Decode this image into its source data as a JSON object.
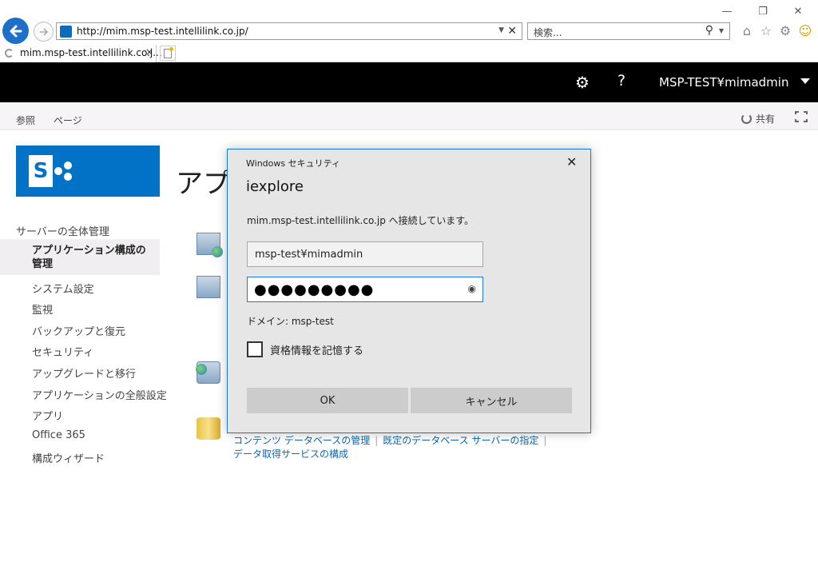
{
  "browser": {
    "url": "http://mim.msp-test.intellilink.co.jp/",
    "search_placeholder": "検索...",
    "tab_title": "mim.msp-test.intellilink.co.j...",
    "tab_close": "×"
  },
  "suite_bar": {
    "user": "MSP-TEST¥mimadmin",
    "help": "?"
  },
  "ribbon": {
    "tabs": [
      "参照",
      "ページ"
    ],
    "share": "共有"
  },
  "page": {
    "title": "アプリケーション構成の管理",
    "logo_letter": "S"
  },
  "left_nav": {
    "heading": "サーバーの全体管理",
    "selected": "アプリケーション構成の管理",
    "items": [
      "システム設定",
      "監視",
      "バックアップと復元",
      "セキュリティ",
      "アップグレードと移行",
      "アプリケーションの全般設定",
      "アプリ",
      "Office 365",
      "構成ウィザード"
    ]
  },
  "content_links": {
    "db_row1": [
      "コンテンツ データベースの管理",
      "既定のデータベース サーバーの指定"
    ],
    "db_row2": "データ取得サービスの構成",
    "separator": "|"
  },
  "dialog": {
    "caption": "Windows セキュリティ",
    "app": "iexplore",
    "message": "mim.msp-test.intellilink.co.jp へ接続しています。",
    "username": "msp-test¥mimadmin",
    "password_mask": "●●●●●●●●●",
    "domain": "ドメイン: msp-test",
    "remember_label": "資格情報を記憶する",
    "remember_checked": false,
    "ok": "OK",
    "cancel": "キャンセル"
  }
}
